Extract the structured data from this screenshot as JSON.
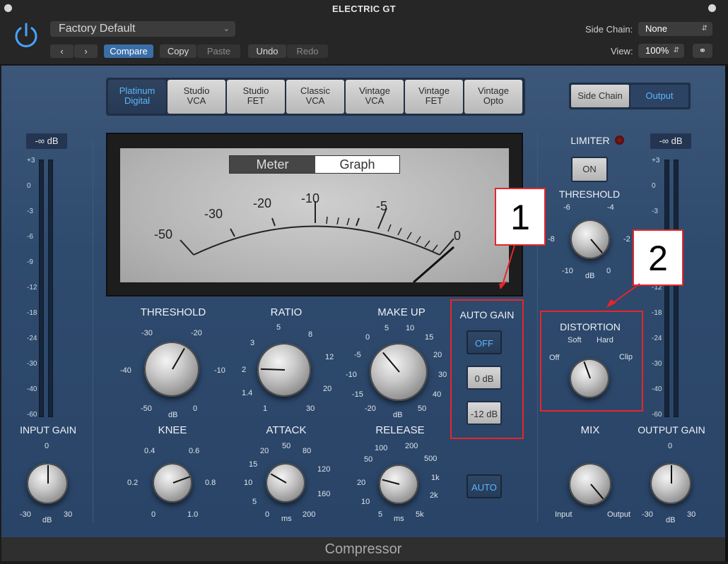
{
  "window": {
    "title": "ELECTRIC GT"
  },
  "header": {
    "preset": "Factory Default",
    "compare": "Compare",
    "copy": "Copy",
    "paste": "Paste",
    "undo": "Undo",
    "redo": "Redo",
    "side_chain_label": "Side Chain:",
    "side_chain_value": "None",
    "view_label": "View:",
    "view_value": "100%"
  },
  "modes": [
    {
      "line1": "Platinum",
      "line2": "Digital"
    },
    {
      "line1": "Studio",
      "line2": "VCA"
    },
    {
      "line1": "Studio",
      "line2": "FET"
    },
    {
      "line1": "Classic",
      "line2": "VCA"
    },
    {
      "line1": "Vintage",
      "line2": "VCA"
    },
    {
      "line1": "Vintage",
      "line2": "FET"
    },
    {
      "line1": "Vintage",
      "line2": "Opto"
    }
  ],
  "side_chain_btn": "Side Chain",
  "output_btn": "Output",
  "input_readout": "-∞ dB",
  "output_readout": "-∞ dB",
  "meter_scale": [
    "+3",
    "0",
    "-3",
    "-6",
    "-9",
    "-12",
    "-18",
    "-24",
    "-30",
    "-40",
    "-60"
  ],
  "meter_tabs": {
    "meter": "Meter",
    "graph": "Graph"
  },
  "vu_scale": [
    "-50",
    "-30",
    "-20",
    "-10",
    "-5",
    "0"
  ],
  "labels": {
    "threshold": "THRESHOLD",
    "ratio": "RATIO",
    "makeup": "MAKE UP",
    "auto_gain": "AUTO GAIN",
    "knee": "KNEE",
    "attack": "ATTACK",
    "release": "RELEASE",
    "limiter": "LIMITER",
    "limiter_threshold": "THRESHOLD",
    "distortion": "DISTORTION",
    "mix": "MIX",
    "input_gain": "INPUT GAIN",
    "output_gain": "OUTPUT GAIN"
  },
  "auto_gain": {
    "off": "OFF",
    "zero": "0 dB",
    "minus12": "-12 dB"
  },
  "release_auto": "AUTO",
  "limiter_on": "ON",
  "threshold_scale": {
    "a": "-30",
    "b": "-20",
    "c": "-40",
    "d": "-10",
    "e": "-50",
    "f": "0",
    "unit": "dB"
  },
  "ratio_scale": {
    "a": "5",
    "b": "3",
    "c": "8",
    "d": "2",
    "e": "12",
    "f": "1.4",
    "g": "20",
    "h": "1",
    "i": "30"
  },
  "makeup_scale": {
    "a": "0",
    "b": "5",
    "c": "10",
    "d": "15",
    "e": "-5",
    "f": "20",
    "g": "-10",
    "h": "30",
    "i": "-15",
    "j": "40",
    "k": "-20",
    "l": "50",
    "unit": "dB"
  },
  "knee_scale": {
    "a": "0.4",
    "b": "0.6",
    "c": "0.2",
    "d": "0.8",
    "e": "0",
    "f": "1.0"
  },
  "attack_scale": {
    "a": "20",
    "b": "50",
    "c": "80",
    "d": "15",
    "e": "120",
    "f": "10",
    "g": "160",
    "h": "5",
    "i": "0",
    "j": "200",
    "unit": "ms"
  },
  "release_scale": {
    "a": "100",
    "b": "200",
    "c": "50",
    "d": "500",
    "e": "1k",
    "f": "20",
    "g": "2k",
    "h": "10",
    "i": "5",
    "j": "5k",
    "unit": "ms"
  },
  "limiter_scale": {
    "a": "-6",
    "b": "-4",
    "c": "-8",
    "d": "-2",
    "e": "-10",
    "f": "0",
    "unit": "dB"
  },
  "distortion_scale": {
    "soft": "Soft",
    "hard": "Hard",
    "off": "Off",
    "clip": "Clip"
  },
  "mix_scale": {
    "input": "Input",
    "output": "Output"
  },
  "input_gain_scale": {
    "top": "0",
    "left": "-30",
    "right": "30",
    "unit": "dB"
  },
  "output_gain_scale": {
    "top": "0",
    "left": "-30",
    "right": "30",
    "unit": "dB"
  },
  "callouts": [
    "1",
    "2"
  ],
  "footer": "Compressor",
  "colors": {
    "accent": "#5bb6ff",
    "annotation": "#e6262a",
    "panel": "#2e4a6d"
  }
}
